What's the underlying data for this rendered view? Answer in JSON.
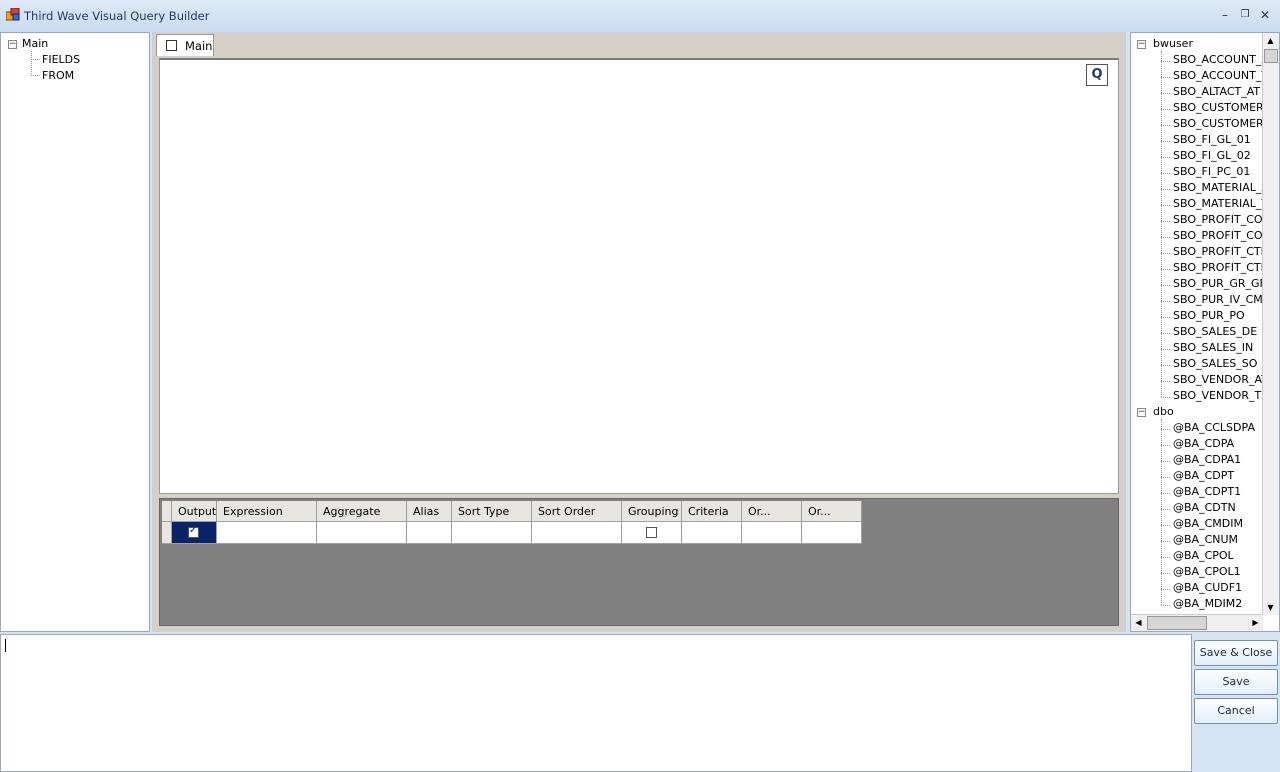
{
  "window": {
    "title": "Third Wave Visual Query Builder",
    "minimize": "–",
    "maximize": "❐",
    "close": "✕"
  },
  "left_tree": {
    "root": "Main",
    "children": [
      "FIELDS",
      "FROM"
    ]
  },
  "tabs": [
    {
      "label": "Main"
    }
  ],
  "canvas": {
    "query_button": "Q"
  },
  "grid": {
    "columns": [
      "Output",
      "Expression",
      "Aggregate",
      "Alias",
      "Sort Type",
      "Sort Order",
      "Grouping",
      "Criteria",
      "Or...",
      "Or..."
    ],
    "rows": [
      {
        "output": true,
        "grouping": false
      }
    ]
  },
  "schema_tree": {
    "groups": [
      {
        "name": "bwuser",
        "items": [
          "SBO_ACCOUNT_A",
          "SBO_ACCOUNT_T",
          "SBO_ALTACT_AT",
          "SBO_CUSTOMER_",
          "SBO_CUSTOMER_",
          "SBO_FI_GL_01",
          "SBO_FI_GL_02",
          "SBO_FI_PC_01",
          "SBO_MATERIAL_A",
          "SBO_MATERIAL_T",
          "SBO_PROFIT_COI",
          "SBO_PROFIT_COI",
          "SBO_PROFIT_CTR",
          "SBO_PROFIT_CTR",
          "SBO_PUR_GR_GF",
          "SBO_PUR_IV_CM",
          "SBO_PUR_PO",
          "SBO_SALES_DE",
          "SBO_SALES_IN",
          "SBO_SALES_SO",
          "SBO_VENDOR_AT",
          "SBO_VENDOR_TE"
        ]
      },
      {
        "name": "dbo",
        "items": [
          "@BA_CCLSDPA",
          "@BA_CDPA",
          "@BA_CDPA1",
          "@BA_CDPT",
          "@BA_CDPT1",
          "@BA_CDTN",
          "@BA_CMDIM",
          "@BA_CNUM",
          "@BA_CPOL",
          "@BA_CPOL1",
          "@BA_CUDF1",
          "@BA_MDIM2"
        ]
      }
    ]
  },
  "editor": {
    "sql_text": ""
  },
  "buttons": {
    "save_close": "Save & Close",
    "save": "Save",
    "cancel": "Cancel"
  }
}
